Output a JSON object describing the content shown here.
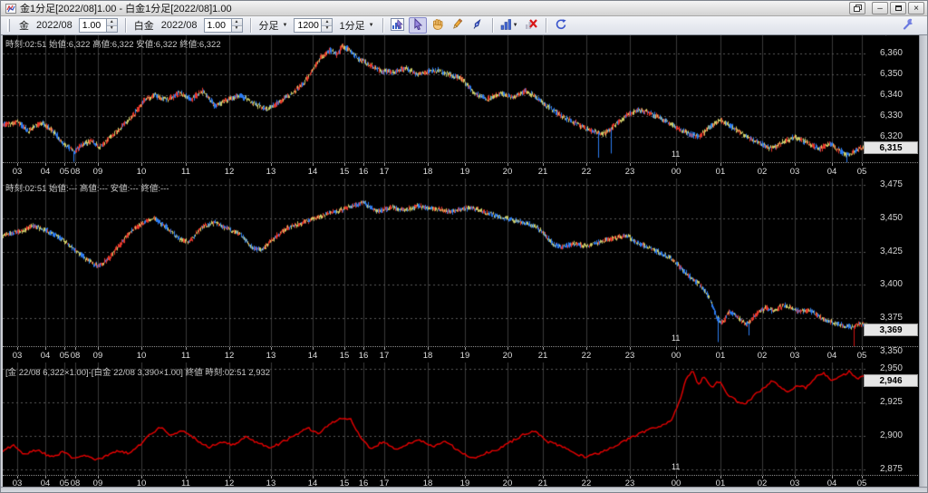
{
  "window": {
    "title": "金1分足[2022/08]1.00 - 白金1分足[2022/08]1.00",
    "controls": {
      "minimize": "–",
      "close": "×"
    }
  },
  "toolbar": {
    "gold": {
      "label": "金",
      "month": "2022/08",
      "multiplier": "1.00"
    },
    "platinum": {
      "label": "白金",
      "month": "2022/08",
      "multiplier": "1.00"
    },
    "period": {
      "label": "分足"
    },
    "bar_count": "1200",
    "interval": {
      "label": "1分足"
    },
    "icons": [
      "chart-pointer-tool",
      "select-tool",
      "hand-pan-tool",
      "pencil-draw-tool",
      "pen-draw-tool",
      "chart-type",
      "delete-drawings",
      "refresh",
      "settings-wrench"
    ]
  },
  "panels": [
    {
      "name": "gold-1min",
      "info": "時刻:02:51 始値:6,322 高値:6,322 安値:6,322 終値:6,322",
      "current": "6,315"
    },
    {
      "name": "platinum-1min",
      "info": "時刻:02:51 始値:--- 高値:--- 安値:--- 終値:---",
      "current": "3,369"
    },
    {
      "name": "gold-platinum-spread",
      "info": "[金 22/08 6,322×1.00]-[白金 22/08 3,390×1.00] 終値 時刻:02:51 2,932",
      "current": "2,946"
    }
  ],
  "time_axis": {
    "hours": [
      [
        "03",
        0.0168
      ],
      [
        "04",
        0.0492
      ],
      [
        "05",
        0.0712
      ],
      [
        "08",
        0.0838
      ],
      [
        "09",
        0.1099
      ],
      [
        "10",
        0.1602
      ],
      [
        "11",
        0.2115
      ],
      [
        "12",
        0.2618
      ],
      [
        "13",
        0.3099
      ],
      [
        "14",
        0.3581
      ],
      [
        "15",
        0.3948
      ],
      [
        "16",
        0.4168
      ],
      [
        "17",
        0.4408
      ],
      [
        "18",
        0.4911
      ],
      [
        "19",
        0.534
      ],
      [
        "20",
        0.5832
      ],
      [
        "21",
        0.6241
      ],
      [
        "22",
        0.6743
      ],
      [
        "23",
        0.7246
      ],
      [
        "00",
        0.778
      ],
      [
        "01",
        0.8293
      ],
      [
        "02",
        0.8775
      ],
      [
        "03",
        0.9152
      ],
      [
        "04",
        0.9581
      ],
      [
        "05",
        0.9927
      ]
    ],
    "date_label": [
      "11",
      0.7707
    ]
  },
  "chart_data": [
    {
      "type": "candlestick",
      "title": "金 1分足 2022/08 ×1.00",
      "bars": 1200,
      "y_gridlines": [
        6370,
        6360,
        6350,
        6340,
        6330,
        6320
      ],
      "ylim": [
        6308,
        6369
      ],
      "last": 6315,
      "colors": {
        "up": "#e8382b",
        "down": "#2d7cf2",
        "flat": "#cdcd68"
      },
      "path": [
        [
          0,
          6326
        ],
        [
          0.017,
          6327
        ],
        [
          0.03,
          6323
        ],
        [
          0.045,
          6327
        ],
        [
          0.06,
          6322
        ],
        [
          0.07,
          6317
        ],
        [
          0.082,
          6313
        ],
        [
          0.092,
          6316
        ],
        [
          0.103,
          6318
        ],
        [
          0.112,
          6315
        ],
        [
          0.125,
          6320
        ],
        [
          0.14,
          6326
        ],
        [
          0.152,
          6331
        ],
        [
          0.163,
          6337
        ],
        [
          0.175,
          6340
        ],
        [
          0.19,
          6338
        ],
        [
          0.205,
          6341
        ],
        [
          0.218,
          6338
        ],
        [
          0.232,
          6342
        ],
        [
          0.245,
          6335
        ],
        [
          0.26,
          6338
        ],
        [
          0.275,
          6340
        ],
        [
          0.29,
          6336
        ],
        [
          0.305,
          6333
        ],
        [
          0.32,
          6337
        ],
        [
          0.335,
          6341
        ],
        [
          0.348,
          6346
        ],
        [
          0.358,
          6352
        ],
        [
          0.368,
          6358
        ],
        [
          0.378,
          6362
        ],
        [
          0.386,
          6359
        ],
        [
          0.393,
          6364
        ],
        [
          0.402,
          6361
        ],
        [
          0.412,
          6357
        ],
        [
          0.422,
          6355
        ],
        [
          0.435,
          6352
        ],
        [
          0.45,
          6351
        ],
        [
          0.465,
          6353
        ],
        [
          0.48,
          6350
        ],
        [
          0.5,
          6352
        ],
        [
          0.515,
          6350
        ],
        [
          0.53,
          6348
        ],
        [
          0.545,
          6341
        ],
        [
          0.56,
          6338
        ],
        [
          0.575,
          6341
        ],
        [
          0.59,
          6339
        ],
        [
          0.605,
          6342
        ],
        [
          0.62,
          6338
        ],
        [
          0.635,
          6333
        ],
        [
          0.65,
          6329
        ],
        [
          0.665,
          6326
        ],
        [
          0.68,
          6323
        ],
        [
          0.693,
          6321
        ],
        [
          0.705,
          6325
        ],
        [
          0.72,
          6330
        ],
        [
          0.735,
          6333
        ],
        [
          0.75,
          6331
        ],
        [
          0.765,
          6328
        ],
        [
          0.78,
          6324
        ],
        [
          0.795,
          6321
        ],
        [
          0.805,
          6320
        ],
        [
          0.818,
          6325
        ],
        [
          0.83,
          6328
        ],
        [
          0.845,
          6324
        ],
        [
          0.86,
          6320
        ],
        [
          0.875,
          6317
        ],
        [
          0.888,
          6314
        ],
        [
          0.9,
          6317
        ],
        [
          0.915,
          6320
        ],
        [
          0.93,
          6317
        ],
        [
          0.945,
          6314
        ],
        [
          0.955,
          6317
        ],
        [
          0.968,
          6313
        ],
        [
          0.978,
          6311
        ],
        [
          0.988,
          6314
        ],
        [
          1,
          6315
        ]
      ],
      "spikes": [
        [
          0.082,
          6308,
          "#2d7cf2"
        ],
        [
          0.688,
          6310,
          "#2d7cf2"
        ],
        [
          0.703,
          6312,
          "#2d7cf2"
        ],
        [
          0.975,
          6306,
          "#2d7cf2"
        ]
      ]
    },
    {
      "type": "candlestick",
      "title": "白金 1分足 2022/08 ×1.00",
      "bars": 1200,
      "y_gridlines": [
        3475,
        3450,
        3425,
        3400,
        3375,
        3350
      ],
      "ylim": [
        3352,
        3480
      ],
      "last": 3369,
      "colors": {
        "up": "#e8382b",
        "down": "#2d7cf2",
        "flat": "#cdcd68"
      },
      "path": [
        [
          0,
          3437
        ],
        [
          0.02,
          3440
        ],
        [
          0.035,
          3444
        ],
        [
          0.05,
          3441
        ],
        [
          0.065,
          3436
        ],
        [
          0.08,
          3428
        ],
        [
          0.095,
          3420
        ],
        [
          0.11,
          3414
        ],
        [
          0.122,
          3419
        ],
        [
          0.135,
          3430
        ],
        [
          0.15,
          3441
        ],
        [
          0.163,
          3447
        ],
        [
          0.175,
          3450
        ],
        [
          0.19,
          3443
        ],
        [
          0.203,
          3435
        ],
        [
          0.215,
          3432
        ],
        [
          0.23,
          3443
        ],
        [
          0.245,
          3447
        ],
        [
          0.26,
          3442
        ],
        [
          0.275,
          3438
        ],
        [
          0.288,
          3428
        ],
        [
          0.3,
          3426
        ],
        [
          0.315,
          3436
        ],
        [
          0.33,
          3443
        ],
        [
          0.345,
          3446
        ],
        [
          0.36,
          3450
        ],
        [
          0.375,
          3453
        ],
        [
          0.39,
          3456
        ],
        [
          0.405,
          3459
        ],
        [
          0.418,
          3462
        ],
        [
          0.432,
          3455
        ],
        [
          0.45,
          3458
        ],
        [
          0.465,
          3456
        ],
        [
          0.48,
          3459
        ],
        [
          0.5,
          3457
        ],
        [
          0.52,
          3455
        ],
        [
          0.54,
          3458
        ],
        [
          0.56,
          3454
        ],
        [
          0.58,
          3450
        ],
        [
          0.6,
          3447
        ],
        [
          0.615,
          3444
        ],
        [
          0.625,
          3439
        ],
        [
          0.635,
          3431
        ],
        [
          0.647,
          3428
        ],
        [
          0.66,
          3431
        ],
        [
          0.675,
          3429
        ],
        [
          0.69,
          3432
        ],
        [
          0.705,
          3435
        ],
        [
          0.72,
          3437
        ],
        [
          0.735,
          3431
        ],
        [
          0.75,
          3427
        ],
        [
          0.762,
          3423
        ],
        [
          0.774,
          3419
        ],
        [
          0.783,
          3413
        ],
        [
          0.792,
          3407
        ],
        [
          0.8,
          3403
        ],
        [
          0.807,
          3399
        ],
        [
          0.813,
          3394
        ],
        [
          0.819,
          3386
        ],
        [
          0.825,
          3376
        ],
        [
          0.831,
          3371
        ],
        [
          0.84,
          3380
        ],
        [
          0.85,
          3375
        ],
        [
          0.86,
          3370
        ],
        [
          0.871,
          3378
        ],
        [
          0.882,
          3383
        ],
        [
          0.892,
          3380
        ],
        [
          0.902,
          3385
        ],
        [
          0.912,
          3382
        ],
        [
          0.922,
          3380
        ],
        [
          0.932,
          3381
        ],
        [
          0.942,
          3377
        ],
        [
          0.952,
          3373
        ],
        [
          0.962,
          3371
        ],
        [
          0.972,
          3369
        ],
        [
          0.982,
          3368
        ],
        [
          0.99,
          3371
        ],
        [
          1,
          3369
        ]
      ],
      "spikes": [
        [
          0.826,
          3357,
          "#2d7cf2"
        ],
        [
          0.862,
          3362,
          "#2d7cf2"
        ],
        [
          0.983,
          3352,
          "#cc1414"
        ]
      ]
    },
    {
      "type": "line",
      "title": "[金]-[白金] スプレッド 終値",
      "last": 2946,
      "color": "#e60000",
      "y_gridlines": [
        2950,
        2925,
        2900,
        2875
      ],
      "ylim": [
        2871,
        2955
      ],
      "path": [
        [
          0,
          2889
        ],
        [
          0.012,
          2893
        ],
        [
          0.025,
          2886
        ],
        [
          0.04,
          2890
        ],
        [
          0.055,
          2884
        ],
        [
          0.07,
          2888
        ],
        [
          0.082,
          2883
        ],
        [
          0.095,
          2886
        ],
        [
          0.108,
          2882
        ],
        [
          0.12,
          2885
        ],
        [
          0.133,
          2889
        ],
        [
          0.147,
          2887
        ],
        [
          0.158,
          2893
        ],
        [
          0.17,
          2901
        ],
        [
          0.183,
          2907
        ],
        [
          0.195,
          2900
        ],
        [
          0.208,
          2904
        ],
        [
          0.222,
          2898
        ],
        [
          0.238,
          2891
        ],
        [
          0.252,
          2896
        ],
        [
          0.265,
          2893
        ],
        [
          0.28,
          2899
        ],
        [
          0.295,
          2895
        ],
        [
          0.31,
          2891
        ],
        [
          0.325,
          2896
        ],
        [
          0.34,
          2901
        ],
        [
          0.352,
          2906
        ],
        [
          0.365,
          2902
        ],
        [
          0.378,
          2909
        ],
        [
          0.392,
          2913
        ],
        [
          0.402,
          2912
        ],
        [
          0.414,
          2898
        ],
        [
          0.425,
          2890
        ],
        [
          0.44,
          2896
        ],
        [
          0.455,
          2890
        ],
        [
          0.468,
          2894
        ],
        [
          0.482,
          2897
        ],
        [
          0.497,
          2892
        ],
        [
          0.512,
          2896
        ],
        [
          0.527,
          2889
        ],
        [
          0.543,
          2883
        ],
        [
          0.558,
          2887
        ],
        [
          0.572,
          2890
        ],
        [
          0.588,
          2896
        ],
        [
          0.602,
          2901
        ],
        [
          0.615,
          2904
        ],
        [
          0.628,
          2896
        ],
        [
          0.643,
          2893
        ],
        [
          0.658,
          2888
        ],
        [
          0.673,
          2884
        ],
        [
          0.688,
          2887
        ],
        [
          0.703,
          2891
        ],
        [
          0.718,
          2896
        ],
        [
          0.733,
          2901
        ],
        [
          0.748,
          2905
        ],
        [
          0.762,
          2908
        ],
        [
          0.773,
          2912
        ],
        [
          0.782,
          2926
        ],
        [
          0.79,
          2943
        ],
        [
          0.797,
          2949
        ],
        [
          0.804,
          2938
        ],
        [
          0.811,
          2945
        ],
        [
          0.819,
          2936
        ],
        [
          0.828,
          2941
        ],
        [
          0.838,
          2931
        ],
        [
          0.848,
          2926
        ],
        [
          0.857,
          2923
        ],
        [
          0.868,
          2930
        ],
        [
          0.878,
          2935
        ],
        [
          0.888,
          2941
        ],
        [
          0.898,
          2937
        ],
        [
          0.908,
          2933
        ],
        [
          0.918,
          2938
        ],
        [
          0.928,
          2936
        ],
        [
          0.938,
          2943
        ],
        [
          0.948,
          2947
        ],
        [
          0.958,
          2941
        ],
        [
          0.968,
          2944
        ],
        [
          0.978,
          2948
        ],
        [
          0.988,
          2943
        ],
        [
          1,
          2946
        ]
      ]
    }
  ]
}
